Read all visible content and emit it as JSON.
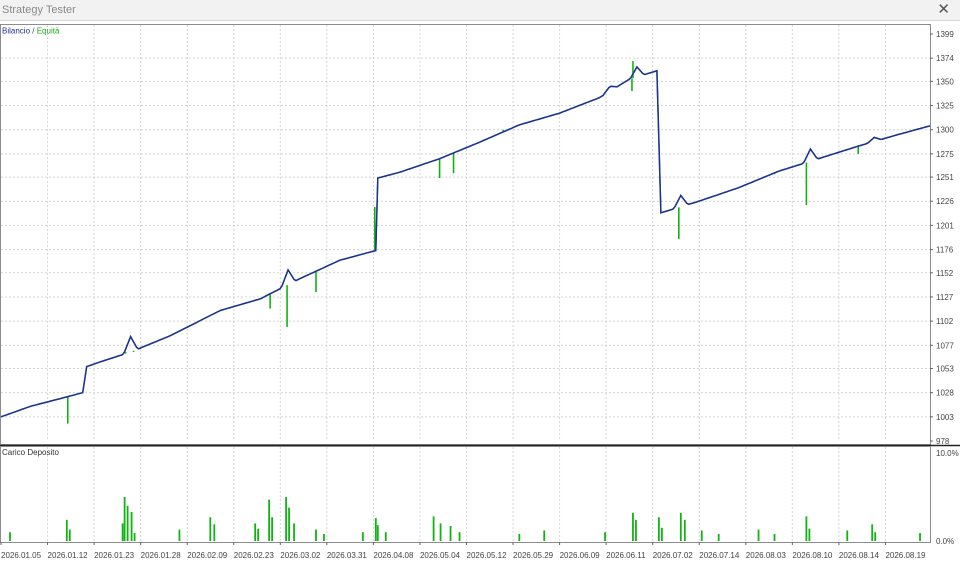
{
  "window": {
    "title": "Strategy Tester",
    "close_icon": "close-icon"
  },
  "legend": {
    "balance": "Bilancio",
    "separator": "/",
    "equity": "Equità"
  },
  "deposit_label": "Carico Deposito",
  "colors": {
    "balance": "#1f2f99",
    "equity": "#12b212",
    "deposit": "#12b212",
    "grid": "#d4d4d4",
    "axis_text": "#444444"
  },
  "chart_data": [
    {
      "type": "line",
      "series": [
        {
          "name": "Bilancio"
        },
        {
          "name": "Equità"
        }
      ],
      "ylim": [
        978,
        1399
      ],
      "y_ticks": [
        "1399",
        "1374",
        "1350",
        "1325",
        "1300",
        "1275",
        "1251",
        "1226",
        "1201",
        "1176",
        "1152",
        "1127",
        "1102",
        "1077",
        "1053",
        "1028",
        "1003",
        "978"
      ],
      "x_ticks": [
        "2026.01.05",
        "2026.01.12",
        "2026.01.23",
        "2026.01.28",
        "2026.02.09",
        "2026.02.23",
        "2026.03.02",
        "2026.03.31",
        "2026.04.08",
        "2026.05.04",
        "2026.05.12",
        "2026.05.29",
        "2026.06.09",
        "2026.06.11",
        "2026.07.02",
        "2026.07.14",
        "2026.08.03",
        "2026.08.10",
        "2026.08.14",
        "2026.08.19"
      ],
      "balance_points": [
        [
          0,
          1003
        ],
        [
          30,
          1014
        ],
        [
          60,
          1022
        ],
        [
          82,
          1028
        ],
        [
          86,
          1055
        ],
        [
          100,
          1060
        ],
        [
          130,
          1070
        ],
        [
          170,
          1087
        ],
        [
          220,
          1113
        ],
        [
          260,
          1125
        ],
        [
          300,
          1146
        ],
        [
          340,
          1165
        ],
        [
          376,
          1175
        ],
        [
          378,
          1250
        ],
        [
          400,
          1256
        ],
        [
          440,
          1270
        ],
        [
          480,
          1287
        ],
        [
          520,
          1305
        ],
        [
          560,
          1317
        ],
        [
          600,
          1333
        ],
        [
          630,
          1352
        ],
        [
          658,
          1361
        ],
        [
          662,
          1214
        ],
        [
          700,
          1226
        ],
        [
          740,
          1240
        ],
        [
          780,
          1257
        ],
        [
          820,
          1270
        ],
        [
          860,
          1283
        ],
        [
          900,
          1295
        ],
        [
          932,
          1304
        ]
      ],
      "balance_bumps": [
        [
          130,
          1086
        ],
        [
          288,
          1155
        ],
        [
          611,
          1345
        ],
        [
          638,
          1365
        ],
        [
          682,
          1232
        ],
        [
          812,
          1280
        ],
        [
          876,
          1292
        ]
      ],
      "equity_dips": [
        [
          67,
          996
        ],
        [
          125,
          1070
        ],
        [
          133,
          1070
        ],
        [
          208,
          1107
        ],
        [
          252,
          1123
        ],
        [
          270,
          1115
        ],
        [
          287,
          1096
        ],
        [
          316,
          1132
        ],
        [
          375,
          1220
        ],
        [
          440,
          1250
        ],
        [
          454,
          1255
        ],
        [
          504,
          1300
        ],
        [
          633,
          1340
        ],
        [
          680,
          1187
        ],
        [
          776,
          1254
        ],
        [
          808,
          1222
        ],
        [
          860,
          1275
        ]
      ],
      "equity_spikes": [
        [
          634,
          1371
        ]
      ]
    },
    {
      "type": "bar",
      "name": "Carico Deposito",
      "ylim": [
        0,
        10
      ],
      "y_ticks": [
        "10.0%",
        "0.0%"
      ],
      "bars": [
        [
          9,
          1.0
        ],
        [
          66,
          2.4
        ],
        [
          69,
          1.3
        ],
        [
          122,
          2.0
        ],
        [
          124,
          5.0
        ],
        [
          127,
          4.0
        ],
        [
          131,
          3.3
        ],
        [
          134,
          0.9
        ],
        [
          179,
          1.3
        ],
        [
          210,
          2.7
        ],
        [
          214,
          1.9
        ],
        [
          255,
          2.0
        ],
        [
          258,
          1.4
        ],
        [
          269,
          4.7
        ],
        [
          272,
          2.7
        ],
        [
          286,
          5.0
        ],
        [
          289,
          3.8
        ],
        [
          294,
          2.0
        ],
        [
          316,
          1.3
        ],
        [
          324,
          0.8
        ],
        [
          363,
          1.0
        ],
        [
          376,
          2.6
        ],
        [
          378,
          1.8
        ],
        [
          386,
          1.0
        ],
        [
          434,
          2.8
        ],
        [
          441,
          2.0
        ],
        [
          451,
          1.7
        ],
        [
          460,
          1.0
        ],
        [
          520,
          0.8
        ],
        [
          545,
          1.2
        ],
        [
          606,
          1.0
        ],
        [
          634,
          3.2
        ],
        [
          637,
          2.4
        ],
        [
          660,
          2.7
        ],
        [
          663,
          1.5
        ],
        [
          682,
          3.2
        ],
        [
          686,
          2.4
        ],
        [
          703,
          1.2
        ],
        [
          720,
          0.8
        ],
        [
          760,
          1.3
        ],
        [
          776,
          0.8
        ],
        [
          808,
          2.8
        ],
        [
          811,
          1.4
        ],
        [
          849,
          1.2
        ],
        [
          874,
          1.9
        ],
        [
          877,
          1.0
        ],
        [
          922,
          0.9
        ]
      ]
    }
  ]
}
